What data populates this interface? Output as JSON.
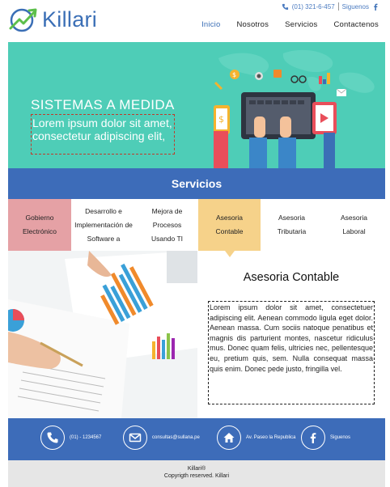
{
  "header": {
    "brand": "Killari",
    "phone": "(01) 321-6-457",
    "follow": "Siguenos",
    "nav": [
      "Inicio",
      "Nosotros",
      "Servicios",
      "Contactenos"
    ]
  },
  "hero": {
    "title": "SISTEMAS A MEDIDA",
    "subtitle": "Lorem ipsum dolor sit amet, consectetur adipiscing elit,"
  },
  "services": {
    "heading": "Servicios",
    "tabs": [
      {
        "label": "Gobierno Electrónico",
        "color": "#e5a1a5"
      },
      {
        "label": "Desarrollo e Implementación de Software a",
        "color": "#ffffff"
      },
      {
        "label": "Mejora de Procesos Usando TI",
        "color": "#ffffff"
      },
      {
        "label": "Asesoria Contable",
        "color": "#f6d28a"
      },
      {
        "label": "Asesoria Tributaria",
        "color": "#ffffff"
      },
      {
        "label": "Asesoria Laboral",
        "color": "#ffffff"
      }
    ]
  },
  "content": {
    "title": "Asesoria Contable",
    "text": "Lorem ipsum dolor sit amet, consectetuer adipiscing elit. Aenean commodo ligula eget dolor. Aenean massa. Cum sociis natoque penatibus et magnis dis parturient montes, nascetur ridiculus mus. Donec quam felis, ultricies nec, pellentesque eu, pretium quis, sem. Nulla consequat massa quis enim. Donec pede justo, fringilla vel."
  },
  "footer": {
    "phone": "(01) - 1234567",
    "email": "consultas@sullana.pe",
    "address": "Av. Paseo la Republica",
    "follow": "Siguenos",
    "brand": "Killari®",
    "copyright": "Copyrigth reserved. Killari"
  },
  "colors": {
    "brand_blue": "#3d6cb9",
    "hero_teal": "#4ecdb7",
    "tab_pink": "#e5a1a5",
    "tab_yellow": "#f6d28a"
  },
  "icons": [
    "logo-arrow-icon",
    "phone-icon",
    "facebook-icon",
    "email-icon",
    "home-icon"
  ]
}
